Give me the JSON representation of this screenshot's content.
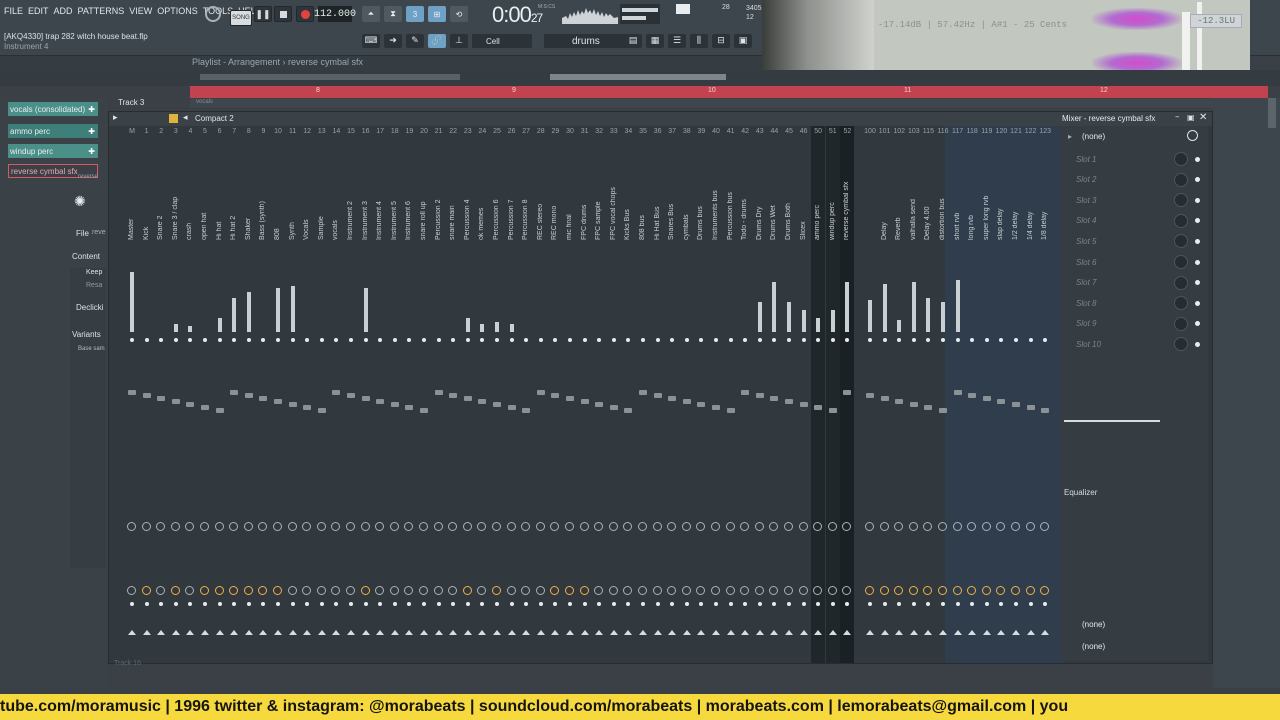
{
  "menu": [
    "FILE",
    "EDIT",
    "ADD",
    "PATTERNS",
    "VIEW",
    "OPTIONS",
    "TOOLS",
    "HELP"
  ],
  "project": {
    "file": "[AKQ4330] trap 282 witch house beat.flp",
    "hint": "Instrument 4"
  },
  "transport": {
    "song_label": "SONG",
    "tempo": "112.000",
    "time_main": "0:00",
    "time_small": "27",
    "mcs": "M:S:CS"
  },
  "counters": {
    "a": "28",
    "b": "3405",
    "c": "12"
  },
  "snap": "Cell",
  "pattern": "drums",
  "scope": {
    "readout": "-17.14dB | 57.42Hz | A#1 - 25 Cents",
    "lu": "-12.3LU"
  },
  "playlist": {
    "title": "Playlist - Arrangement › reverse cymbal sfx",
    "track_label": "Track 3",
    "clip_label": "vocals",
    "footer_track": "Track 16"
  },
  "ruler": [
    "8",
    "9",
    "10",
    "11",
    "12"
  ],
  "browser": {
    "items": [
      {
        "label": "vocals (consolidated)",
        "style": "sel"
      },
      {
        "label": "ammo perc",
        "style": "plain"
      },
      {
        "label": "windup perc",
        "style": "sel"
      },
      {
        "label": "reverse cymbal sfx",
        "style": "outline"
      }
    ],
    "tab_label": "reverse",
    "file_label": "File",
    "file_value": "reve",
    "content_label": "Content",
    "keep_label": "Keep",
    "resample_label": "Resa",
    "declick_label": "Declicki",
    "variants_label": "Variants",
    "base_label": "Base sam"
  },
  "mixer": {
    "preset": "Compact 2",
    "name": "Mixer - reverse cymbal sfx",
    "channels": [
      "Master",
      "Kick",
      "Snare 2",
      "Snare 3 / clap",
      "crash",
      "open hat",
      "Hi hat",
      "Hi hat 2",
      "Shaker",
      "Bass (synth)",
      "808",
      "Synth",
      "Vocals",
      "Sample",
      "vocals",
      "Instrument 2",
      "Instrument 3",
      "Instrument 4",
      "Instrument 5",
      "Instrument 6",
      "snare roll up",
      "Percussion 2",
      "snare main",
      "Percussion 4",
      "ok memes",
      "Percussion 6",
      "Percussion 7",
      "Percussion 8",
      "REC stereo",
      "REC mono",
      "mic final",
      "FPC drums",
      "FPC sample",
      "FPC vocal chops",
      "Kicks Bus",
      "808 bus",
      "Hi Hat Bus",
      "Snares Bus",
      "cymbals",
      "Drums bus",
      "Instruments bus",
      "Percussion bus",
      "Todo - drums",
      "Drums Dry",
      "Drums Wet",
      "Drums Both",
      "Slicex",
      "ammo perc",
      "windup perc",
      "reverse cymbal sfx",
      "",
      "Delay",
      "Reverb",
      "valhalla send",
      "Delay 4.00",
      "distortion bus",
      "short rvb",
      "long rvb",
      "super long rvb",
      "slap delay",
      "1/2 delay",
      "1/4 delay",
      "1/8 delay"
    ],
    "numbers": [
      "M",
      "1",
      "2",
      "3",
      "4",
      "5",
      "6",
      "7",
      "8",
      "9",
      "10",
      "11",
      "12",
      "13",
      "14",
      "15",
      "16",
      "17",
      "18",
      "19",
      "20",
      "21",
      "22",
      "23",
      "24",
      "25",
      "26",
      "27",
      "28",
      "29",
      "30",
      "31",
      "32",
      "33",
      "34",
      "35",
      "36",
      "37",
      "38",
      "39",
      "40",
      "41",
      "42",
      "43",
      "44",
      "45",
      "46",
      "50",
      "51",
      "52",
      "100",
      "101",
      "102",
      "103",
      "115",
      "116",
      "117",
      "118",
      "119",
      "120",
      "121",
      "122",
      "123"
    ],
    "meters": [
      60,
      0,
      0,
      8,
      6,
      0,
      14,
      34,
      40,
      0,
      44,
      46,
      0,
      0,
      0,
      0,
      44,
      0,
      0,
      0,
      0,
      0,
      0,
      14,
      8,
      10,
      8,
      0,
      0,
      0,
      0,
      0,
      0,
      0,
      0,
      0,
      0,
      0,
      0,
      0,
      0,
      0,
      0,
      30,
      50,
      30,
      22,
      14,
      22,
      50,
      32,
      48,
      12,
      50,
      34,
      30,
      52,
      0,
      0,
      0,
      0,
      0,
      0
    ],
    "orange_knobs": [
      1,
      3,
      5,
      6,
      7,
      8,
      9,
      10,
      16,
      23,
      25,
      29,
      30,
      31
    ],
    "slots_none": "(none)",
    "slots": [
      "Slot 1",
      "Slot 2",
      "Slot 3",
      "Slot 4",
      "Slot 5",
      "Slot 6",
      "Slot 7",
      "Slot 8",
      "Slot 9",
      "Slot 10"
    ],
    "eq_label": "Equalizer",
    "send_none_1": "(none)",
    "send_none_2": "(none)"
  },
  "marquee": "tube.com/moramusic  |  1996  twitter & instagram: @morabeats  |  soundcloud.com/morabeats  |  morabeats.com  |  lemorabeats@gmail.com  |  you",
  "colors": {
    "accent": "#c2434f",
    "marquee": "#f6d93c",
    "browser_sel": "#4a8f88"
  }
}
